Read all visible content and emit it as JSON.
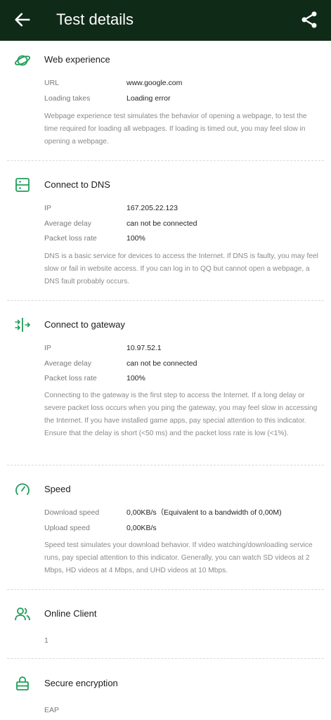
{
  "header": {
    "title": "Test details"
  },
  "sections": {
    "web": {
      "title": "Web experience",
      "rows": [
        {
          "label": "URL",
          "value": "www.google.com"
        },
        {
          "label": "Loading takes",
          "value": "Loading error"
        }
      ],
      "desc": "Webpage experience test simulates the behavior of opening a webpage, to test the time required for loading all webpages. If loading is timed out, you may feel slow in opening a webpage."
    },
    "dns": {
      "title": "Connect to DNS",
      "rows": [
        {
          "label": "IP",
          "value": "167.205.22.123"
        },
        {
          "label": "Average delay",
          "value": "can not be connected"
        },
        {
          "label": "Packet loss rate",
          "value": "100%"
        }
      ],
      "desc": "DNS is a basic service for devices to access the Internet. If DNS is faulty, you may feel slow or fail in website access. If you can log in to QQ but cannot open a webpage, a DNS fault probably occurs."
    },
    "gateway": {
      "title": "Connect to gateway",
      "rows": [
        {
          "label": "IP",
          "value": "10.97.52.1"
        },
        {
          "label": "Average delay",
          "value": "can not be connected"
        },
        {
          "label": "Packet loss rate",
          "value": "100%"
        }
      ],
      "desc": "Connecting to the gateway is the first step to access the Internet. If a long delay or severe packet loss occurs when you ping the gateway, you may feel slow in accessing the Internet. If you have installed game apps, pay special attention to this indicator. Ensure that the delay is short (<50 ms) and the packet loss rate is low (<1%)."
    },
    "speed": {
      "title": "Speed",
      "rows": [
        {
          "label": "Download speed",
          "value": "0,00KB/s（Equivalent to a bandwidth of 0,00M)"
        },
        {
          "label": "Upload speed",
          "value": "0,00KB/s"
        }
      ],
      "desc": "Speed test simulates your download behavior. If video watching/downloading service runs, pay special attention to this indicator. Generally, you can watch SD videos at 2 Mbps, HD videos at 4 Mbps, and UHD videos at 10 Mbps."
    },
    "clients": {
      "title": "Online Client",
      "value": "1"
    },
    "encryption": {
      "title": "Secure encryption",
      "value": "EAP"
    }
  },
  "colors": {
    "header_bg": "#102a18",
    "icon_green": "#1e9e5a"
  }
}
